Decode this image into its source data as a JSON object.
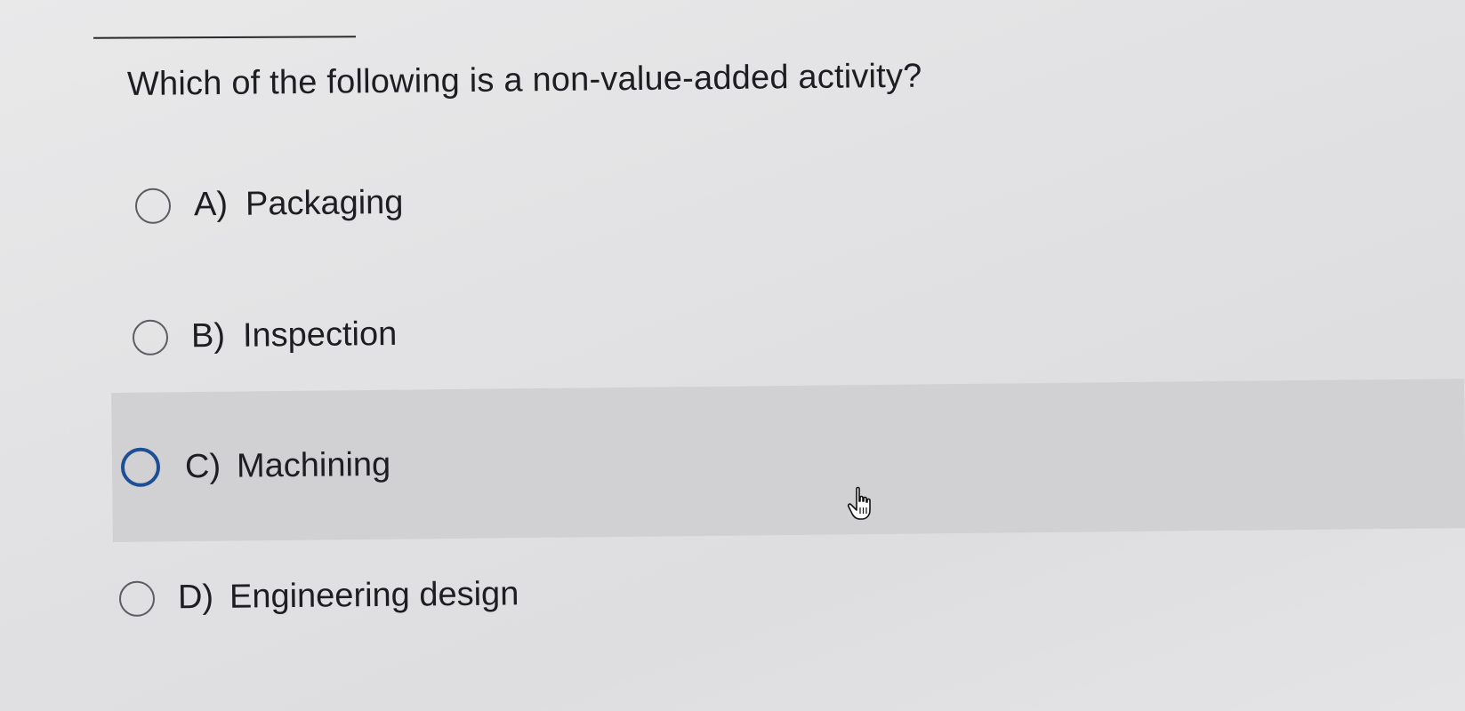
{
  "question": {
    "text": "Which of the following is a non-value-added activity?"
  },
  "options": [
    {
      "letter": "A)",
      "label": "Packaging"
    },
    {
      "letter": "B)",
      "label": "Inspection"
    },
    {
      "letter": "C)",
      "label": "Machining"
    },
    {
      "letter": "D)",
      "label": "Engineering design"
    }
  ],
  "state": {
    "hovered_option": "C)",
    "selected_option": null
  },
  "icons": {
    "radio": "radio-button-icon",
    "pointer": "hand-pointer-cursor-icon"
  },
  "colors": {
    "focus_ring": "#1d4f96",
    "hover_band": "#d1d1d3"
  }
}
